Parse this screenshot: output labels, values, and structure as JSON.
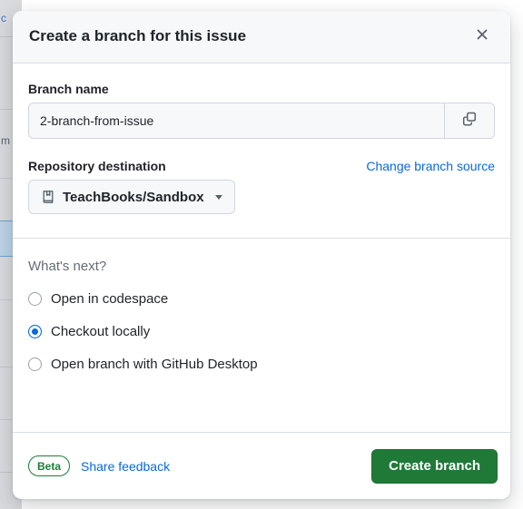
{
  "background": {
    "clipped_link_text": "c",
    "clipped_text_mid": "m"
  },
  "dialog": {
    "title": "Create a branch for this issue",
    "close_icon": "close-icon",
    "branch_name": {
      "label": "Branch name",
      "value": "2-branch-from-issue",
      "placeholder": "Branch name",
      "copy_icon": "copy-icon"
    },
    "repository": {
      "label": "Repository destination",
      "change_source_link": "Change branch source",
      "selected": "TeachBooks/Sandbox",
      "repo_icon": "repo-icon",
      "caret_icon": "chevron-down-icon"
    },
    "whats_next": {
      "heading": "What's next?",
      "options": [
        {
          "label": "Open in codespace",
          "checked": false
        },
        {
          "label": "Checkout locally",
          "checked": true
        },
        {
          "label": "Open branch with GitHub Desktop",
          "checked": false
        }
      ]
    },
    "footer": {
      "beta_badge": "Beta",
      "feedback_link": "Share feedback",
      "primary_button": "Create branch"
    }
  },
  "colors": {
    "accent_blue": "#0969da",
    "success_green": "#1f7a38",
    "beta_green": "#1a7f37",
    "header_bg": "#f6f8fa",
    "border": "#d0d7de",
    "text": "#1f2328",
    "muted_text": "#656c76"
  }
}
